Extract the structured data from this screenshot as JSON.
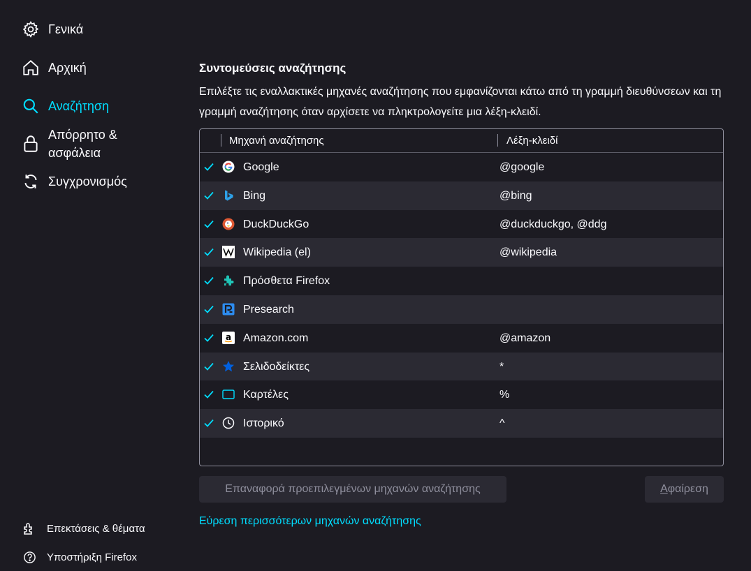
{
  "sidebar": {
    "items": [
      {
        "label": "Γενικά",
        "icon": "gear-icon"
      },
      {
        "label": "Αρχική",
        "icon": "home-icon"
      },
      {
        "label": "Αναζήτηση",
        "icon": "search-icon",
        "active": true
      },
      {
        "label_line1": "Απόρρητο &",
        "label_line2": "ασφάλεια",
        "icon": "lock-icon"
      },
      {
        "label": "Συγχρονισμός",
        "icon": "sync-icon"
      }
    ],
    "footer": [
      {
        "label": "Επεκτάσεις & θέματα",
        "icon": "puzzle-icon"
      },
      {
        "label": "Υποστήριξη Firefox",
        "icon": "help-icon"
      }
    ]
  },
  "section": {
    "heading": "Συντομεύσεις αναζήτησης",
    "description": "Επιλέξτε τις εναλλακτικές μηχανές αναζήτησης που εμφανίζονται κάτω από τη γραμμή διευθύνσεων και τη γραμμή αναζήτησης όταν αρχίσετε να πληκτρολογείτε μια λέξη-κλειδί."
  },
  "table": {
    "columns": [
      "Μηχανή αναζήτησης",
      "Λέξη-κλειδί"
    ],
    "rows": [
      {
        "name": "Google",
        "keyword": "@google",
        "checked": true,
        "icon": "google-icon"
      },
      {
        "name": "Bing",
        "keyword": "@bing",
        "checked": true,
        "icon": "bing-icon"
      },
      {
        "name": "DuckDuckGo",
        "keyword": "@duckduckgo, @ddg",
        "checked": true,
        "icon": "duckduckgo-icon"
      },
      {
        "name": "Wikipedia (el)",
        "keyword": "@wikipedia",
        "checked": true,
        "icon": "wikipedia-icon"
      },
      {
        "name": "Πρόσθετα Firefox",
        "keyword": "",
        "checked": true,
        "icon": "addons-icon"
      },
      {
        "name": "Presearch",
        "keyword": "",
        "checked": true,
        "icon": "presearch-icon"
      },
      {
        "name": "Amazon.com",
        "keyword": "@amazon",
        "checked": true,
        "icon": "amazon-icon"
      },
      {
        "name": "Σελιδοδείκτες",
        "keyword": "*",
        "checked": true,
        "icon": "bookmark-star-icon"
      },
      {
        "name": "Καρτέλες",
        "keyword": "%",
        "checked": true,
        "icon": "tab-icon"
      },
      {
        "name": "Ιστορικό",
        "keyword": "^",
        "checked": true,
        "icon": "history-clock-icon"
      }
    ]
  },
  "buttons": {
    "restore": "Επαναφορά προεπιλεγμένων μηχανών αναζήτησης",
    "remove_access": "Α",
    "remove_rest": "φαίρεση"
  },
  "link": "Εύρεση περισσότερων μηχανών αναζήτησης",
  "colors": {
    "accent": "#00ddff",
    "background": "#1c1b22",
    "row_alt": "#2b2a33"
  }
}
